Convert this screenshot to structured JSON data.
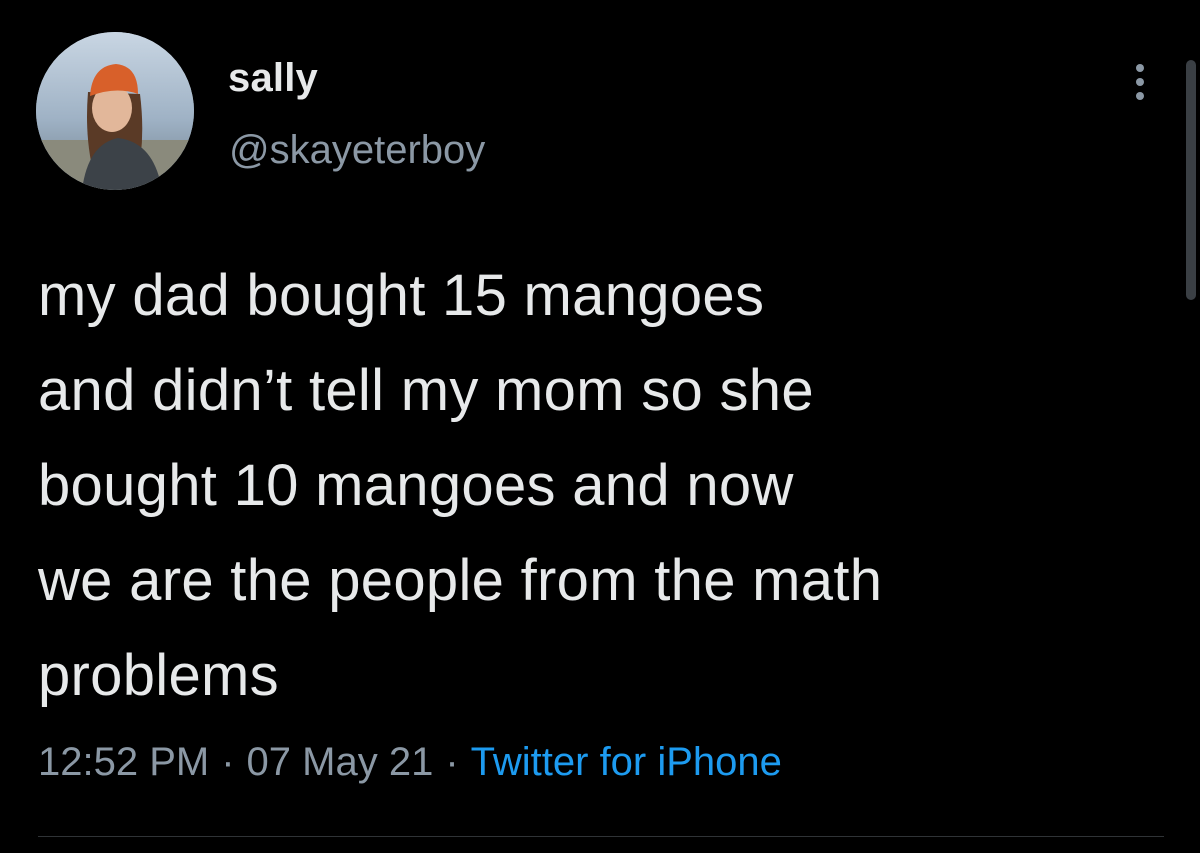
{
  "tweet": {
    "display_name": "sally",
    "handle": "@skayeterboy",
    "more_icon": "more-vertical-icon",
    "body_lines": [
      "my dad bought 15 mangoes",
      "and didn’t tell my mom so she",
      "bought 10 mangoes and now",
      "we are the people from the math",
      "problems"
    ],
    "time": "12:52 PM",
    "date": "07 May 21",
    "separator": "·",
    "source": "Twitter for iPhone"
  },
  "colors": {
    "background": "#000000",
    "text": "#e7e9ea",
    "secondary": "#8b98a5",
    "link": "#1d9bf0"
  }
}
